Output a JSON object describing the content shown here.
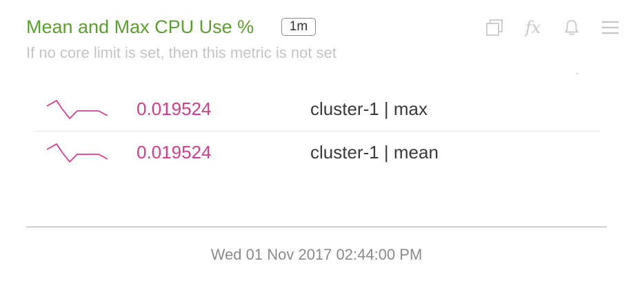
{
  "panel": {
    "title": "Mean and Max CPU Use %",
    "interval": "1m",
    "subtitle": "If no core limit is set, then this metric is not set",
    "timestamp": "Wed 01 Nov 2017 02:44:00 PM"
  },
  "toolbar": {
    "icons": [
      "copy-icon",
      "fx-icon",
      "bell-icon",
      "menu-icon"
    ],
    "fx_glyph": "fx"
  },
  "colors": {
    "title": "#5aa02c",
    "series": "#d63c8e",
    "subtitle": "#c4c4c4"
  },
  "series": [
    {
      "value": "0.019524",
      "label": "cluster-1 | max"
    },
    {
      "value": "0.019524",
      "label": "cluster-1 | mean"
    }
  ]
}
